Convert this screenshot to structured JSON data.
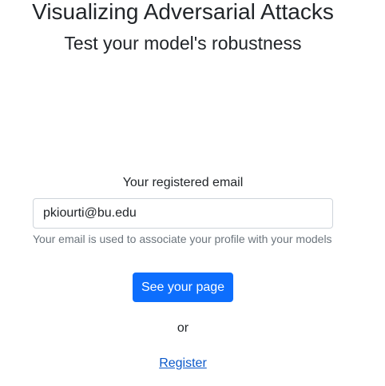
{
  "header": {
    "title": "Visualizing Adversarial Attacks",
    "subtitle": "Test your model's robustness"
  },
  "form": {
    "email_label": "Your registered email",
    "email_value": "pkiourti@bu.edu",
    "help_text": "Your email is used to associate your profile with your models",
    "submit_label": "See your page"
  },
  "alt": {
    "or_text": "or",
    "register_label": "Register"
  },
  "colors": {
    "primary": "#0d6efd",
    "link": "#0a58ca",
    "muted": "#6c757d",
    "text": "#212529"
  }
}
